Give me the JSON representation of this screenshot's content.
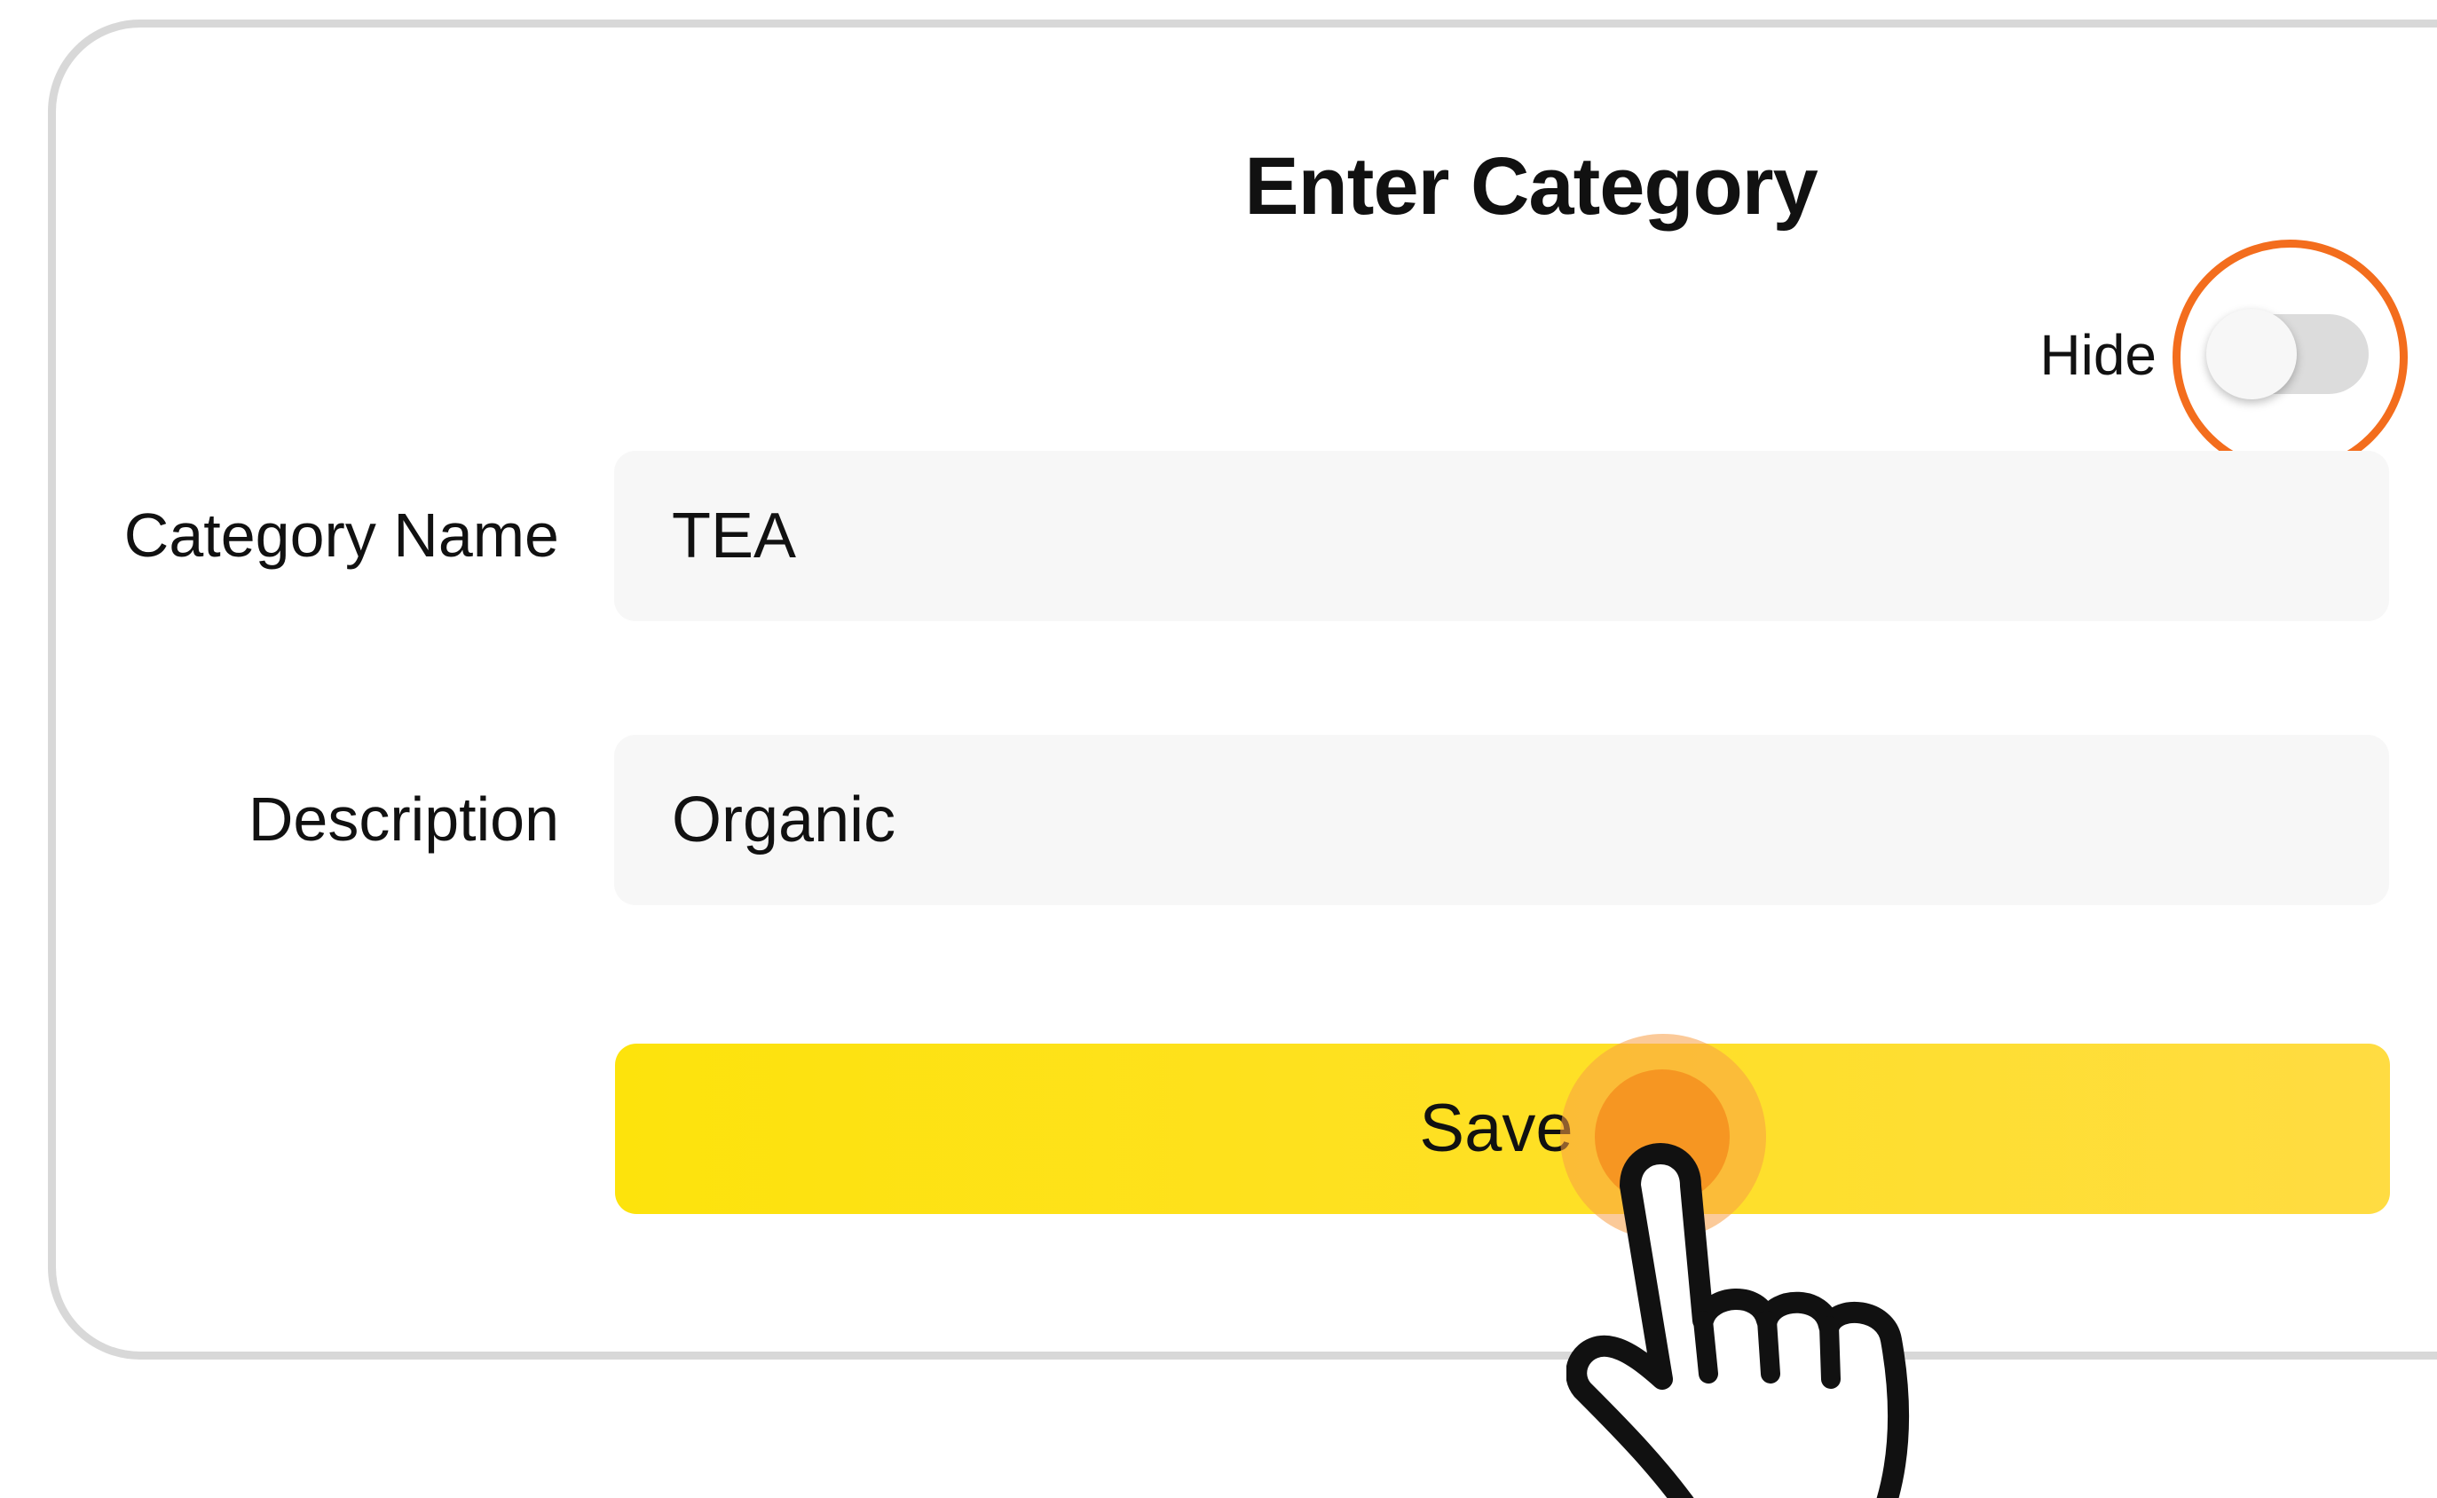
{
  "dialog": {
    "title": "Enter Category",
    "hide_label": "Hide",
    "hide_toggle_on": false
  },
  "form": {
    "category_name": {
      "label": "Category Name",
      "value": "TEA"
    },
    "description": {
      "label": "Description",
      "value": "Organic"
    },
    "save_label": "Save"
  },
  "colors": {
    "accent_yellow": "#fde30c",
    "highlight_orange": "#f36d1d",
    "tap_orange": "#f69622"
  },
  "overlays": {
    "pointer": "hand-pointer-icon",
    "toggle_highlight": "highlight-ring"
  }
}
